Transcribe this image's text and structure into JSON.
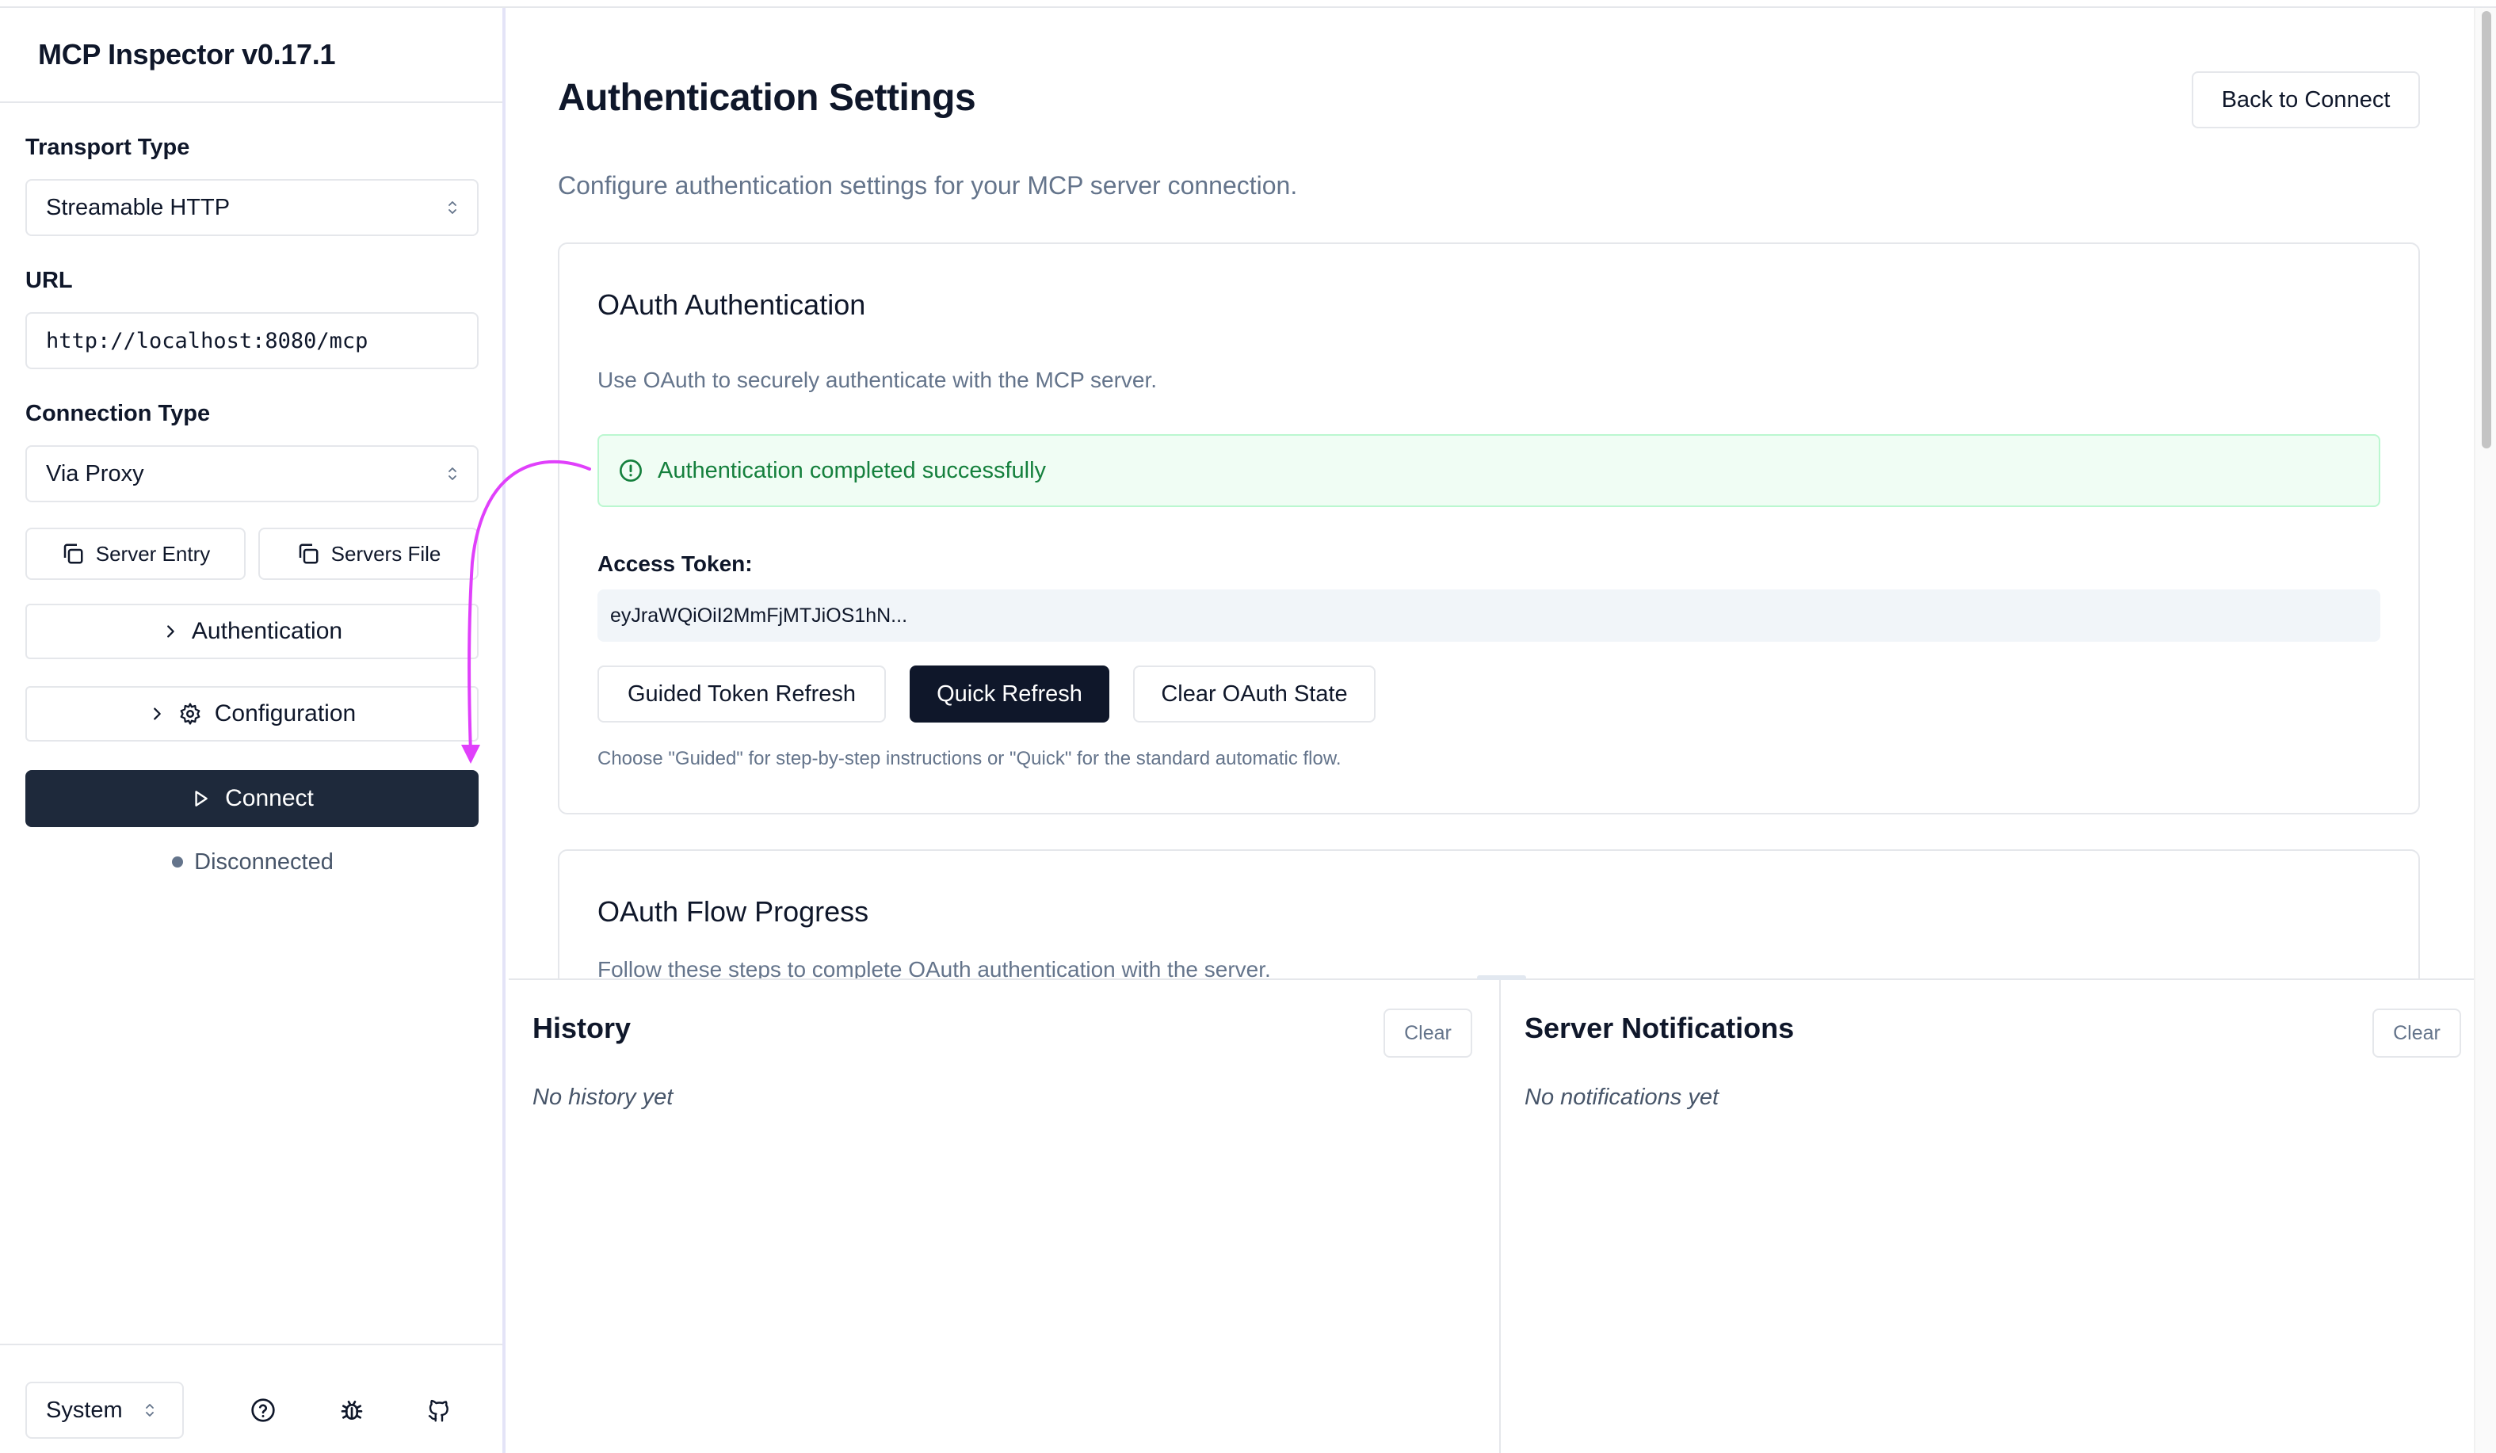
{
  "app": {
    "title": "MCP Inspector v0.17.1"
  },
  "sidebar": {
    "transport_label": "Transport Type",
    "transport_value": "Streamable HTTP",
    "url_label": "URL",
    "url_value": "http://localhost:8080/mcp",
    "connection_label": "Connection Type",
    "connection_value": "Via Proxy",
    "server_entry_label": "Server Entry",
    "servers_file_label": "Servers File",
    "authentication_label": "Authentication",
    "configuration_label": "Configuration",
    "connect_label": "Connect",
    "status_text": "Disconnected",
    "theme_value": "System"
  },
  "main": {
    "title": "Authentication Settings",
    "back_label": "Back to Connect",
    "description": "Configure authentication settings for your MCP server connection.",
    "oauth_card": {
      "title": "OAuth Authentication",
      "description": "Use OAuth to securely authenticate with the MCP server.",
      "alert": "Authentication completed successfully",
      "token_label": "Access Token:",
      "token_value": "eyJraWQiOiI2MmFjMTJiOS1hN...",
      "guided_label": "Guided Token Refresh",
      "quick_label": "Quick Refresh",
      "clear_label": "Clear OAuth State",
      "hint": "Choose \"Guided\" for step-by-step instructions or \"Quick\" for the standard automatic flow."
    },
    "flow_card": {
      "title": "OAuth Flow Progress",
      "description": "Follow these steps to complete OAuth authentication with the server."
    }
  },
  "history": {
    "title": "History",
    "clear_label": "Clear",
    "empty": "No history yet"
  },
  "notifications": {
    "title": "Server Notifications",
    "clear_label": "Clear",
    "empty": "No notifications yet"
  },
  "colors": {
    "accent_dark": "#0f172a",
    "success": "#15803d",
    "annotation": "#e040fb"
  },
  "icons": [
    "copy-icon",
    "chevron-right-icon",
    "gear-icon",
    "play-icon",
    "alert-circle-icon",
    "help-circle-icon",
    "bug-icon",
    "github-icon",
    "chevron-up-down-icon"
  ]
}
